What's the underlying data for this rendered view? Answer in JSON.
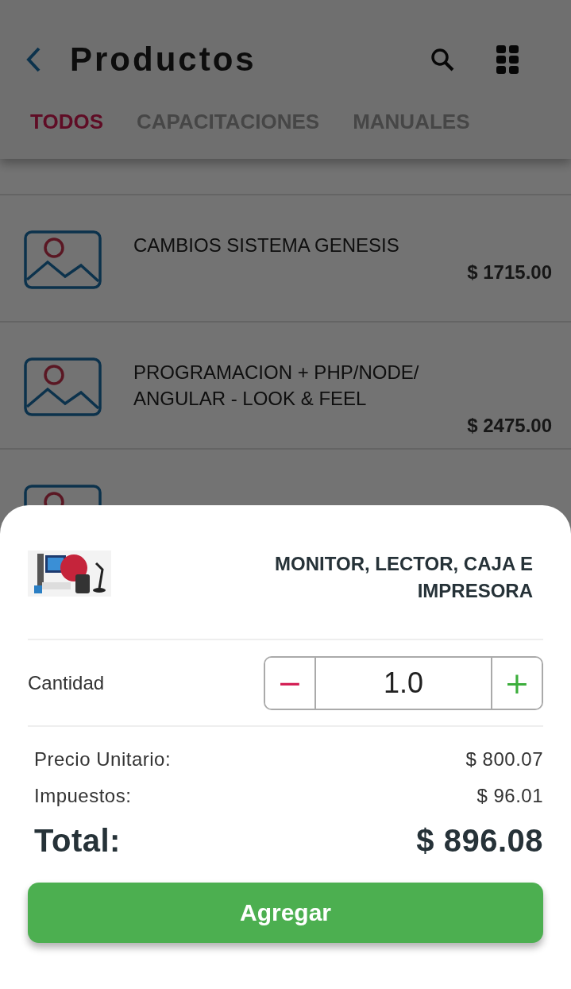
{
  "header": {
    "title": "Productos"
  },
  "tabs": [
    {
      "label": "TODOS",
      "selected": true
    },
    {
      "label": "CAPACITACIONES",
      "selected": false
    },
    {
      "label": "MANUALES",
      "selected": false
    }
  ],
  "products": [
    {
      "name": "CAMBIOS SISTEMA GENESIS",
      "price": "$ 1715.00"
    },
    {
      "name": "PROGRAMACION + PHP/NODE/ ANGULAR - LOOK & FEEL",
      "price": "$ 2475.00"
    }
  ],
  "sheet": {
    "product": {
      "name": "MONITOR, LECTOR, CAJA E IMPRESORA"
    },
    "quantity": {
      "label": "Cantidad",
      "value": "1.0",
      "decrement": "−",
      "increment": "+"
    },
    "lines": [
      {
        "label": "Precio Unitario:",
        "value": "$ 800.07"
      },
      {
        "label": "Impuestos:",
        "value": "$ 96.01"
      }
    ],
    "total": {
      "label": "Total:",
      "value": "$ 896.08"
    },
    "button": "Agregar"
  }
}
